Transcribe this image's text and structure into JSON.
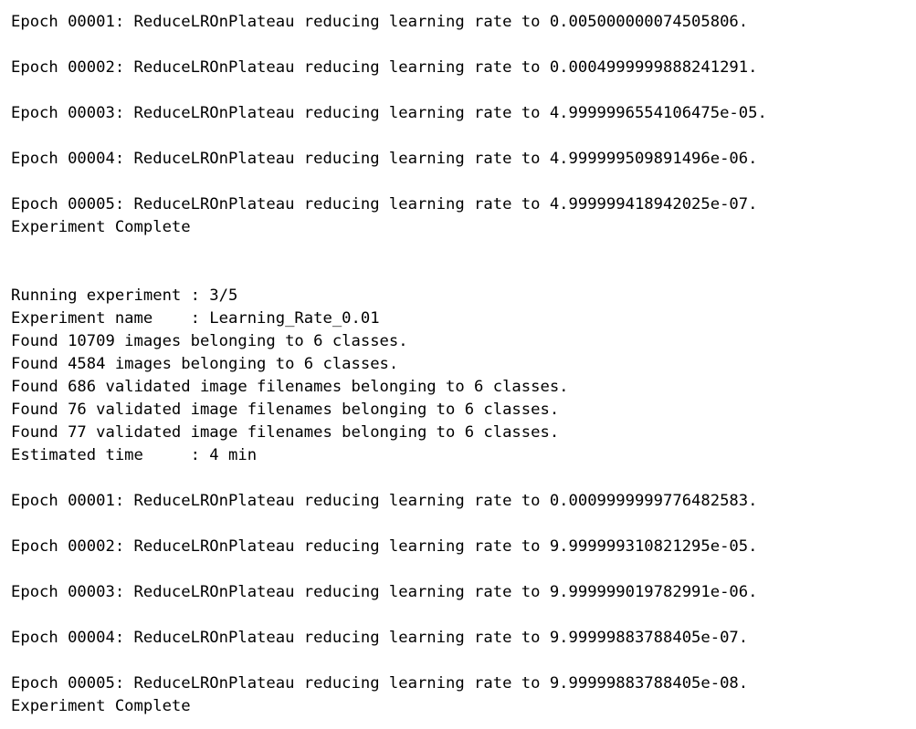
{
  "output": {
    "lines": [
      "Epoch 00001: ReduceLROnPlateau reducing learning rate to 0.005000000074505806.",
      "",
      "Epoch 00002: ReduceLROnPlateau reducing learning rate to 0.0004999999888241291.",
      "",
      "Epoch 00003: ReduceLROnPlateau reducing learning rate to 4.9999996554106475e-05.",
      "",
      "Epoch 00004: ReduceLROnPlateau reducing learning rate to 4.999999509891496e-06.",
      "",
      "Epoch 00005: ReduceLROnPlateau reducing learning rate to 4.999999418942025e-07.",
      "Experiment Complete",
      "",
      "",
      "Running experiment : 3/5",
      "Experiment name    : Learning_Rate_0.01",
      "Found 10709 images belonging to 6 classes.",
      "Found 4584 images belonging to 6 classes.",
      "Found 686 validated image filenames belonging to 6 classes.",
      "Found 76 validated image filenames belonging to 6 classes.",
      "Found 77 validated image filenames belonging to 6 classes.",
      "Estimated time     : 4 min",
      "",
      "Epoch 00001: ReduceLROnPlateau reducing learning rate to 0.0009999999776482583.",
      "",
      "Epoch 00002: ReduceLROnPlateau reducing learning rate to 9.999999310821295e-05.",
      "",
      "Epoch 00003: ReduceLROnPlateau reducing learning rate to 9.999999019782991e-06.",
      "",
      "Epoch 00004: ReduceLROnPlateau reducing learning rate to 9.99999883788405e-07.",
      "",
      "Epoch 00005: ReduceLROnPlateau reducing learning rate to 9.99999883788405e-08.",
      "Experiment Complete"
    ]
  }
}
